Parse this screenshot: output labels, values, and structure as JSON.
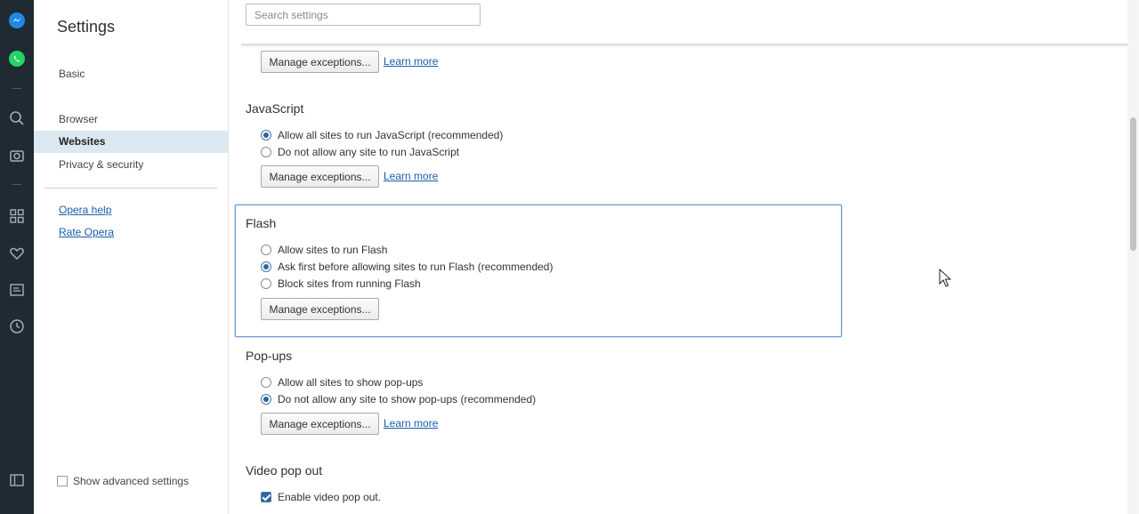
{
  "app": {
    "sidebar_icons": [
      "messenger-icon",
      "whatsapp-icon",
      "search-icon",
      "camera-icon",
      "apps-grid-icon",
      "heart-icon",
      "news-icon",
      "history-icon",
      "sidebar-toggle-icon"
    ],
    "accent_color": "#2f63a3"
  },
  "nav": {
    "title": "Settings",
    "items": [
      {
        "label": "Basic",
        "active": false
      },
      {
        "label": "Browser",
        "active": false
      },
      {
        "label": "Websites",
        "active": true
      },
      {
        "label": "Privacy & security",
        "active": false
      }
    ],
    "links": [
      "Opera help",
      "Rate Opera"
    ],
    "advanced_label": "Show advanced settings"
  },
  "search": {
    "placeholder": "Search settings"
  },
  "content": {
    "top_manage_label": "Manage exceptions...",
    "top_learn_label": "Learn more",
    "javascript": {
      "title": "JavaScript",
      "options": [
        "Allow all sites to run JavaScript (recommended)",
        "Do not allow any site to run JavaScript"
      ],
      "selected": 0,
      "manage_label": "Manage exceptions...",
      "learn_label": "Learn more"
    },
    "flash": {
      "title": "Flash",
      "options": [
        "Allow sites to run Flash",
        "Ask first before allowing sites to run Flash (recommended)",
        "Block sites from running Flash"
      ],
      "selected": 1,
      "manage_label": "Manage exceptions..."
    },
    "popups": {
      "title": "Pop-ups",
      "options": [
        "Allow all sites to show pop-ups",
        "Do not allow any site to show pop-ups (recommended)"
      ],
      "selected": 1,
      "manage_label": "Manage exceptions...",
      "learn_label": "Learn more"
    },
    "video": {
      "title": "Video pop out",
      "checkbox_label": "Enable video pop out.",
      "checked": true
    }
  }
}
